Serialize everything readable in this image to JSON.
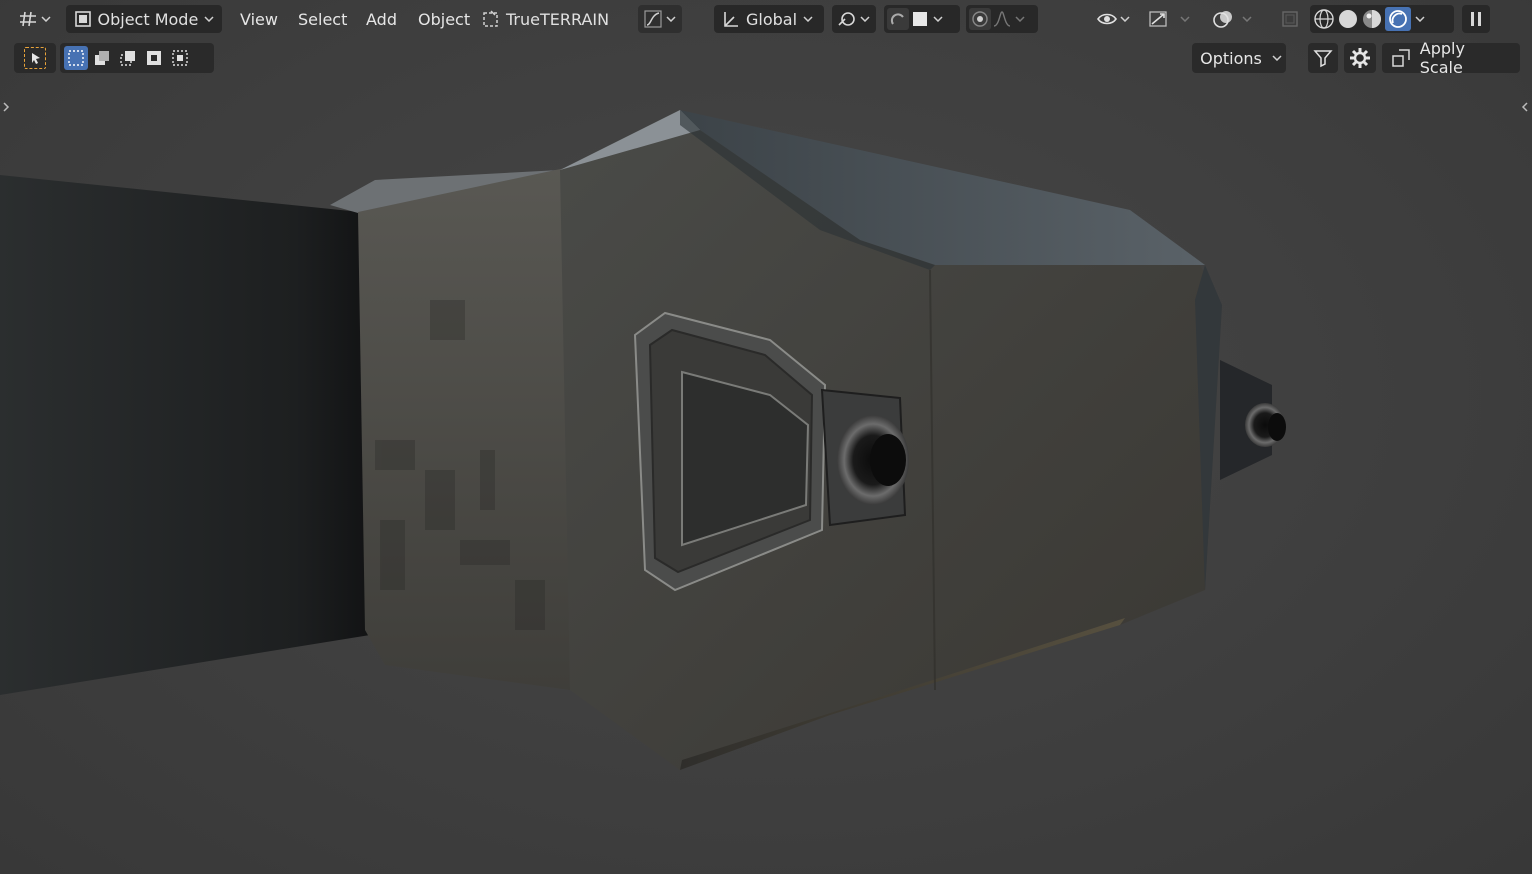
{
  "header": {
    "editor_type_icon": "viewport-grid-icon",
    "mode_label": "Object Mode",
    "menus": [
      "View",
      "Select",
      "Add",
      "Object"
    ],
    "addon_label": "TrueTERRAIN",
    "transform_orientation": "Global"
  },
  "toolbar": {
    "options_label": "Options",
    "apply_scale_label": "Apply Scale"
  },
  "colors": {
    "accent": "#4772b3",
    "viewport_bg": "#3d3d3d",
    "header_bg": "#282828",
    "active_tool_outline": "#e8a33a"
  },
  "icons": [
    "select-tool-icon",
    "selection-mode-icon",
    "snap-icon",
    "pivot-icon",
    "proportional-edit-icon",
    "visibility-icon",
    "gizmo-icon",
    "overlay-icon",
    "xray-icon",
    "wireframe-shading-icon",
    "solid-shading-icon",
    "material-shading-icon",
    "rendered-shading-icon",
    "pause-icon",
    "filter-icon",
    "gear-icon"
  ]
}
